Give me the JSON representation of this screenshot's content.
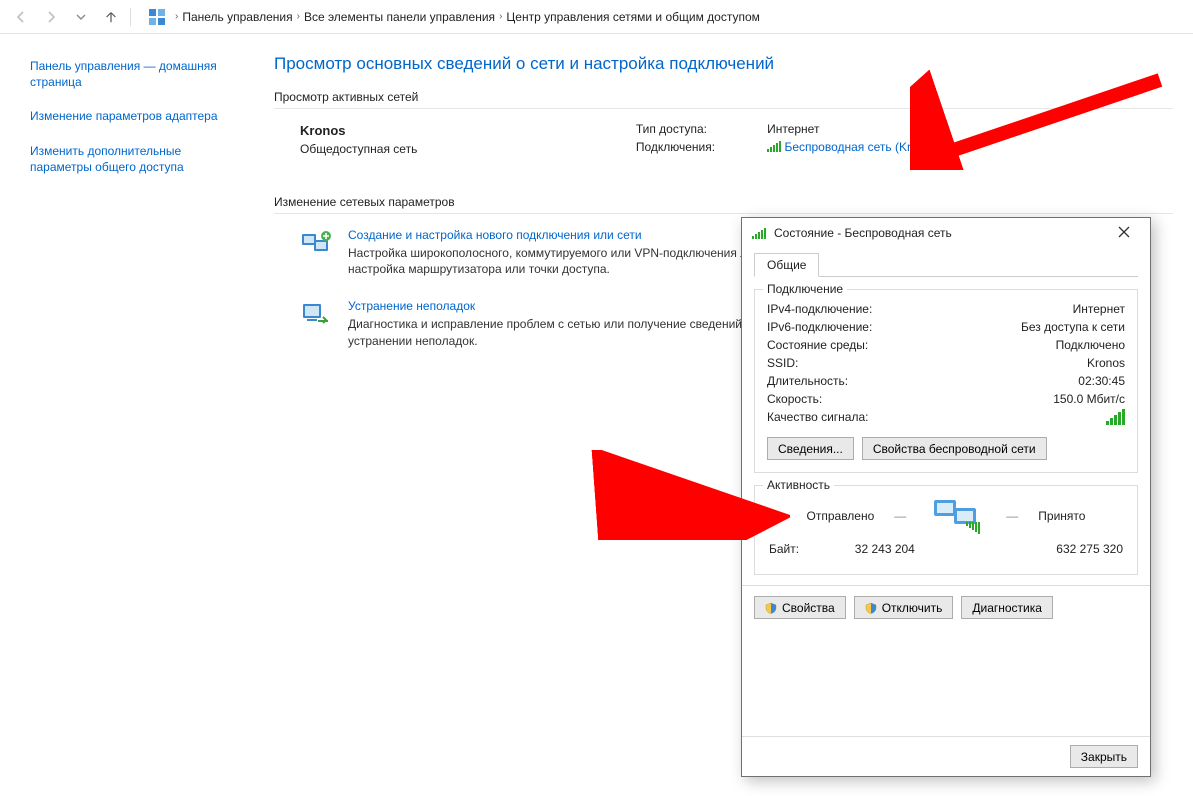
{
  "breadcrumb": {
    "items": [
      "Панель управления",
      "Все элементы панели управления",
      "Центр управления сетями и общим доступом"
    ]
  },
  "sidebar": {
    "items": [
      "Панель управления — домашняя страница",
      "Изменение параметров адаптера",
      "Изменить дополнительные параметры общего доступа"
    ]
  },
  "page": {
    "title": "Просмотр основных сведений о сети и настройка подключений",
    "active_label": "Просмотр активных сетей",
    "network": {
      "name": "Kronos",
      "type": "Общедоступная сеть",
      "access_label": "Тип доступа:",
      "access_value": "Интернет",
      "conn_label": "Подключения:",
      "conn_value": "Беспроводная сеть (Kronos)"
    },
    "change_label": "Изменение сетевых параметров",
    "change_items": [
      {
        "title": "Создание и настройка нового подключения или сети",
        "desc": "Настройка широкополосного, коммутируемого или VPN-подключения либо настройка маршрутизатора или точки доступа."
      },
      {
        "title": "Устранение неполадок",
        "desc": "Диагностика и исправление проблем с сетью или получение сведений об устранении неполадок."
      }
    ]
  },
  "dialog": {
    "title": "Состояние - Беспроводная сеть",
    "tab": "Общие",
    "conn_group": "Подключение",
    "rows": {
      "ipv4_l": "IPv4-подключение:",
      "ipv4_v": "Интернет",
      "ipv6_l": "IPv6-подключение:",
      "ipv6_v": "Без доступа к сети",
      "media_l": "Состояние среды:",
      "media_v": "Подключено",
      "ssid_l": "SSID:",
      "ssid_v": "Kronos",
      "dur_l": "Длительность:",
      "dur_v": "02:30:45",
      "speed_l": "Скорость:",
      "speed_v": "150.0 Мбит/с",
      "signal_l": "Качество сигнала:"
    },
    "btn_details": "Сведения...",
    "btn_wprops": "Свойства беспроводной сети",
    "act_group": "Активность",
    "sent": "Отправлено",
    "recv": "Принято",
    "bytes_l": "Байт:",
    "bytes_sent": "32 243 204",
    "bytes_recv": "632 275 320",
    "btn_props": "Свойства",
    "btn_disable": "Отключить",
    "btn_diag": "Диагностика",
    "btn_close": "Закрыть"
  }
}
